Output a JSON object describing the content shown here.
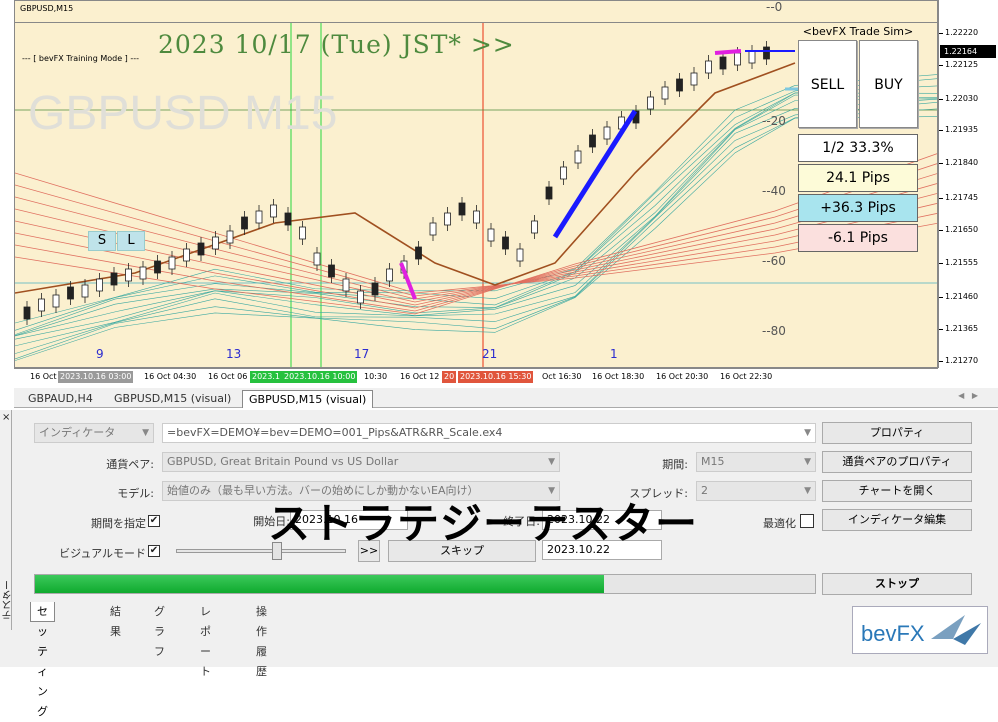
{
  "chart": {
    "symbol": "GBPUSD,M15",
    "training_mode": "--- [ bevFX Training Mode ] ---",
    "date_banner": "2023 10/17 (Tue) JST* >>",
    "watermark": "GBPUSD  M15",
    "sl_buttons": [
      "S",
      "L"
    ],
    "levels": [
      "--0",
      "--20",
      "--40",
      "--60",
      "--80"
    ],
    "bar_numbers": [
      "9",
      "13",
      "17",
      "21",
      "1"
    ],
    "price_ticks": [
      "1.22220",
      "1.22125",
      "1.22030",
      "1.21935",
      "1.21840",
      "1.21745",
      "1.21650",
      "1.21555",
      "1.21460",
      "1.21365",
      "1.21270"
    ],
    "current_price": "1.22164",
    "time_ticks": [
      "16 Oct 20",
      "16 Oct 04:30",
      "16 Oct 06",
      "10:30",
      "16 Oct 12",
      "Oct 16:30",
      "16 Oct 18:30",
      "16 Oct 20:30",
      "16 Oct 22:30"
    ],
    "time_highlights": [
      {
        "label": "2023.10.16 03:00",
        "color": "#9a9a9a"
      },
      {
        "label": "2023.1",
        "color": "#26c13e"
      },
      {
        "label": "2023.10.16 10:00",
        "color": "#26c13e"
      },
      {
        "label": "20",
        "color": "#e0553c"
      },
      {
        "label": "2023.10.16 15:30",
        "color": "#e0553c"
      }
    ]
  },
  "trade_sim": {
    "title": "<bevFX Trade Sim>",
    "sell": "SELL",
    "buy": "BUY",
    "ratio": "1/2   33.3%",
    "tp": "24.1 Pips",
    "total": "+36.3 Pips",
    "sl": "-6.1  Pips"
  },
  "chart_tabs": [
    "GBPAUD,H4",
    "GBPUSD,M15 (visual)",
    "GBPUSD,M15 (visual)"
  ],
  "tester": {
    "side_label": "テスター",
    "close": "×",
    "type_select": "インディケータ",
    "indicator_path": "=bevFX=DEMO¥=bev=DEMO=001_Pips&ATR&RR_Scale.ex4",
    "symbol_label": "通貨ペア:",
    "symbol_value": "GBPUSD, Great Britain Pound vs US Dollar",
    "period_label": "期間:",
    "period_value": "M15",
    "model_label": "モデル:",
    "model_value": "始値のみ（最も早い方法。バーの始めにしか動かないEA向け）",
    "spread_label": "スプレッド:",
    "spread_value": "2",
    "date_check_label": "期間を指定",
    "start_label": "開始日:",
    "start_value": "2023.10.16",
    "end_label": "終了日:",
    "end_value": "2023.10.22",
    "optimize_label": "最適化",
    "visual_label": "ビジュアルモード",
    "ff_button": ">>",
    "skip_button": "スキップ",
    "skip_date": "2023.10.22",
    "btn_properties": "プロパティ",
    "btn_symbol_props": "通貨ペアのプロパティ",
    "btn_open_chart": "チャートを開く",
    "btn_edit_indicator": "インディケータ編集",
    "btn_stop": "ストップ",
    "progress": 0.73,
    "overlay_title": "ストラテジーテスター",
    "bottom_tabs": [
      "セッティング",
      "結果",
      "グラフ",
      "レポート",
      "操作履歴"
    ]
  },
  "logo": "bevFX",
  "colors": {
    "chart_bg": "#fbf0cf",
    "buy_arrow": "#1a1aff",
    "sell_arrow": "#e020e0",
    "progress": "#12ad33"
  }
}
